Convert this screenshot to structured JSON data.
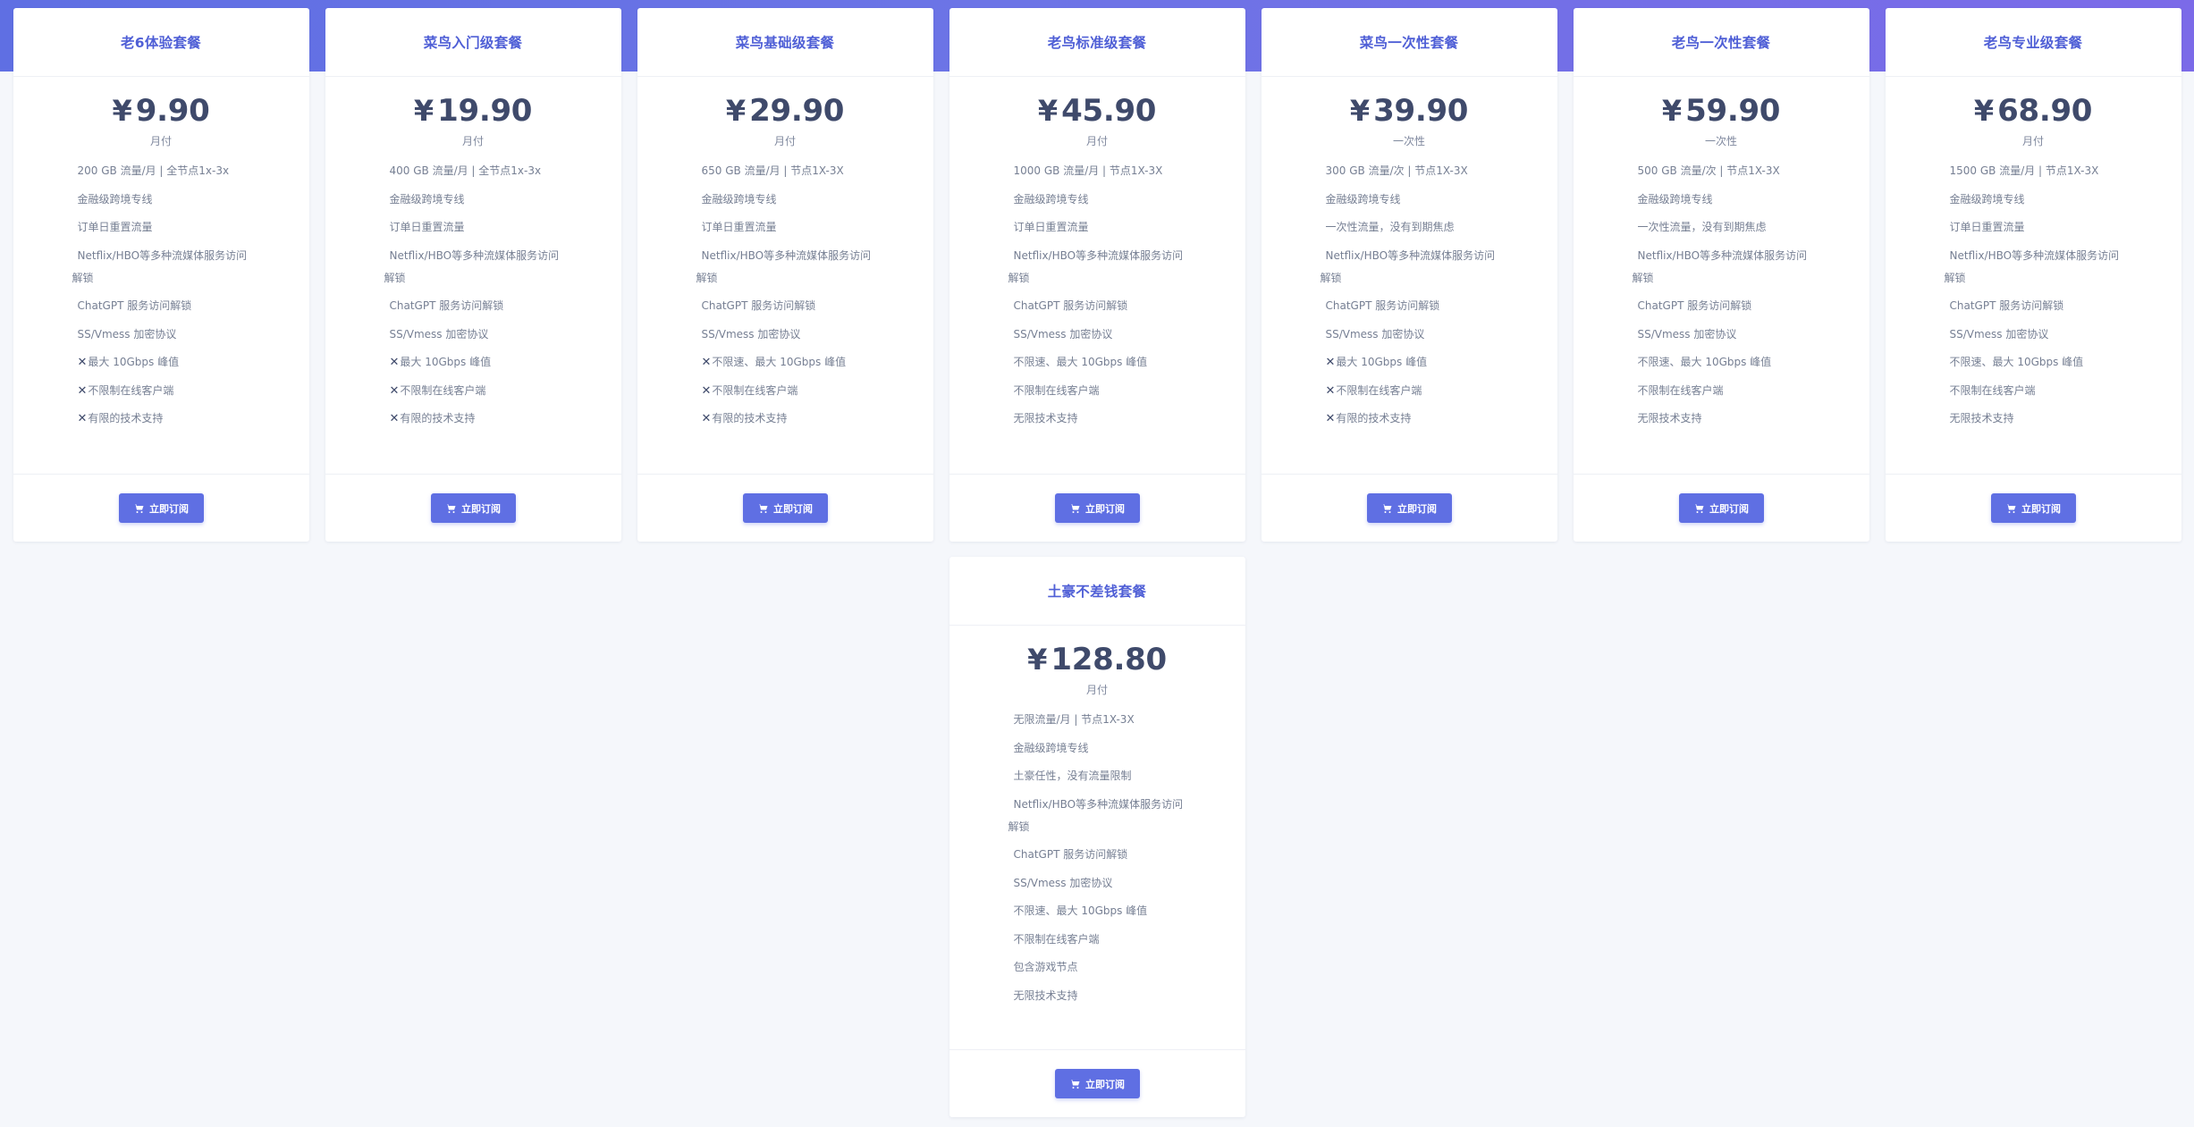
{
  "ui": {
    "currency_symbol": "¥",
    "subscribe_label": "立即订阅",
    "cart_icon": "shopping-cart-icon",
    "accent_color": "#5f6fe3",
    "title_color": "#4f5fd6",
    "price_color": "#3f4a6b"
  },
  "plans": [
    {
      "name": "老6体验套餐",
      "price": "9.90",
      "period": "月付",
      "features": [
        "200 GB 流量/月 | 全节点1x-3x",
        "金融级跨境专线",
        "订单日重置流量",
        "Netflix/HBO等多种流媒体服务访问解锁",
        "ChatGPT 服务访问解锁",
        "SS/Vmess 加密协议",
        "✕最大 10Gbps 峰值",
        "✕不限制在线客户端",
        "✕有限的技术支持"
      ]
    },
    {
      "name": "菜鸟入门级套餐",
      "price": "19.90",
      "period": "月付",
      "features": [
        "400 GB 流量/月 | 全节点1x-3x",
        "金融级跨境专线",
        "订单日重置流量",
        "Netflix/HBO等多种流媒体服务访问解锁",
        "ChatGPT 服务访问解锁",
        "SS/Vmess 加密协议",
        "✕最大 10Gbps 峰值",
        "✕不限制在线客户端",
        "✕有限的技术支持"
      ]
    },
    {
      "name": "菜鸟基础级套餐",
      "price": "29.90",
      "period": "月付",
      "features": [
        "650 GB 流量/月 | 节点1X-3X",
        "金融级跨境专线",
        "订单日重置流量",
        "Netflix/HBO等多种流媒体服务访问解锁",
        "ChatGPT 服务访问解锁",
        "SS/Vmess 加密协议",
        "✕不限速、最大 10Gbps 峰值",
        "✕不限制在线客户端",
        "✕有限的技术支持"
      ]
    },
    {
      "name": "老鸟标准级套餐",
      "price": "45.90",
      "period": "月付",
      "features": [
        "1000 GB 流量/月 | 节点1X-3X",
        "金融级跨境专线",
        "订单日重置流量",
        "Netflix/HBO等多种流媒体服务访问解锁",
        "ChatGPT 服务访问解锁",
        "SS/Vmess 加密协议",
        "不限速、最大 10Gbps 峰值",
        "不限制在线客户端",
        "无限技术支持"
      ]
    },
    {
      "name": "菜鸟一次性套餐",
      "price": "39.90",
      "period": "一次性",
      "features": [
        "300 GB 流量/次 | 节点1X-3X",
        "金融级跨境专线",
        "一次性流量，没有到期焦虑",
        "Netflix/HBO等多种流媒体服务访问解锁",
        "ChatGPT 服务访问解锁",
        "SS/Vmess 加密协议",
        "✕最大 10Gbps 峰值",
        "✕不限制在线客户端",
        "✕有限的技术支持"
      ]
    },
    {
      "name": "老鸟一次性套餐",
      "price": "59.90",
      "period": "一次性",
      "features": [
        "500 GB 流量/次 | 节点1X-3X",
        "金融级跨境专线",
        "一次性流量，没有到期焦虑",
        "Netflix/HBO等多种流媒体服务访问解锁",
        "ChatGPT 服务访问解锁",
        "SS/Vmess 加密协议",
        "不限速、最大 10Gbps 峰值",
        "不限制在线客户端",
        "无限技术支持"
      ]
    },
    {
      "name": "老鸟专业级套餐",
      "price": "68.90",
      "period": "月付",
      "features": [
        "1500 GB 流量/月 | 节点1X-3X",
        "金融级跨境专线",
        "订单日重置流量",
        "Netflix/HBO等多种流媒体服务访问解锁",
        "ChatGPT 服务访问解锁",
        "SS/Vmess 加密协议",
        "不限速、最大 10Gbps 峰值",
        "不限制在线客户端",
        "无限技术支持"
      ]
    },
    {
      "name": "土豪不差钱套餐",
      "price": "128.80",
      "period": "月付",
      "features": [
        "无限流量/月 | 节点1X-3X",
        "金融级跨境专线",
        "土豪任性，没有流量限制",
        "Netflix/HBO等多种流媒体服务访问解锁",
        "ChatGPT 服务访问解锁",
        "SS/Vmess 加密协议",
        "不限速、最大 10Gbps 峰值",
        "不限制在线客户端",
        "包含游戏节点",
        "无限技术支持"
      ]
    }
  ]
}
